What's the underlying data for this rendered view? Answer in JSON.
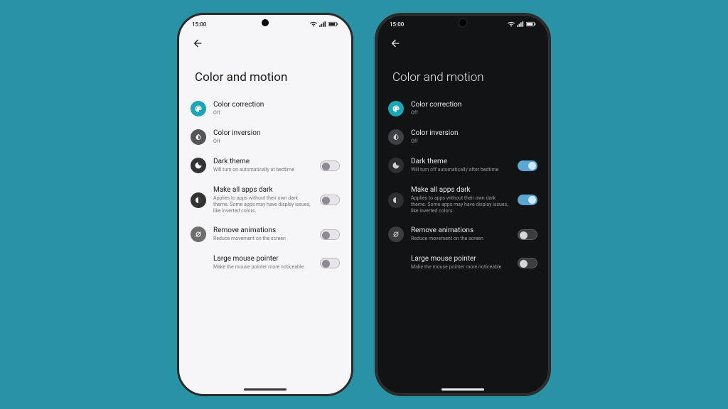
{
  "background_color": "#2a92a5",
  "phones": {
    "light": {
      "status": {
        "time": "15:00",
        "signal": true,
        "wifi": true,
        "battery": true
      },
      "page_title": "Color and motion",
      "items": {
        "color_correction": {
          "label": "Color correction",
          "sub": "Off"
        },
        "color_inversion": {
          "label": "Color inversion",
          "sub": "Off"
        },
        "dark_theme": {
          "label": "Dark theme",
          "sub": "Will turn on automatically at bedtime",
          "toggle": false
        },
        "make_all_dark": {
          "label": "Make all apps dark",
          "sub": "Applies to apps without their own dark theme. Some apps may have display issues, like inverted colors.",
          "toggle": false
        },
        "remove_anim": {
          "label": "Remove animations",
          "sub": "Reduce movement on the screen",
          "toggle": false
        },
        "large_pointer": {
          "label": "Large mouse pointer",
          "sub": "Make the mouse pointer more noticeable",
          "toggle": false
        }
      }
    },
    "dark": {
      "status": {
        "time": "15:00",
        "signal": true,
        "wifi": true,
        "battery": true
      },
      "page_title": "Color and motion",
      "items": {
        "color_correction": {
          "label": "Color correction",
          "sub": "Off"
        },
        "color_inversion": {
          "label": "Color inversion",
          "sub": "Off"
        },
        "dark_theme": {
          "label": "Dark theme",
          "sub": "Will turn off automatically after bedtime",
          "toggle": true
        },
        "make_all_dark": {
          "label": "Make all apps dark",
          "sub": "Applies to apps without their own dark theme. Some apps may have display issues, like inverted colors.",
          "toggle": true
        },
        "remove_anim": {
          "label": "Remove animations",
          "sub": "Reduce movement on the screen",
          "toggle": false
        },
        "large_pointer": {
          "label": "Large mouse pointer",
          "sub": "Make the mouse pointer more noticeable",
          "toggle": false
        }
      }
    }
  }
}
